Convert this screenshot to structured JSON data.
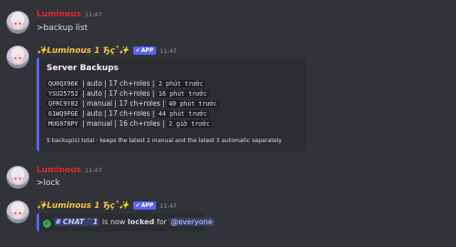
{
  "messages": [
    {
      "username": "Luminous",
      "time": "11:47",
      "text": ">backup list"
    },
    {
      "username": "✨Luminous 1 Ђç˚✨",
      "badge": "APP",
      "time": "11:47",
      "embed": {
        "title": "Server Backups",
        "rows": [
          {
            "id": "QU0QX96K",
            "type": "auto",
            "roles": "17 ch+roles",
            "age": "2 phút trước"
          },
          {
            "id": "YSU25752",
            "type": "auto",
            "roles": "17 ch+roles",
            "age": "16 phút trước"
          },
          {
            "id": "QFRC9Y02",
            "type": "manual",
            "roles": "17 ch+roles",
            "age": "40 phút trước"
          },
          {
            "id": "61WQ9PGE",
            "type": "auto",
            "roles": "17 ch+roles",
            "age": "44 phút trước"
          },
          {
            "id": "MUG978PY",
            "type": "manual",
            "roles": "16 ch+roles",
            "age": "2 giờ trước"
          }
        ],
        "footer": "5 backup(s) total · keeps the latest 2 manual and the latest 3 automatic separately"
      }
    },
    {
      "username": "Luminous",
      "time": "11:47",
      "text": ">lock"
    },
    {
      "username": "✨Luminous 1 Ђç˚✨",
      "badge": "APP",
      "time": "11:47",
      "lock": {
        "channel": "# CHAT ˙ 1",
        "is_now": "is now",
        "locked": "locked",
        "for": "for",
        "mention": "@everyone"
      }
    }
  ],
  "colors": {
    "background": "#313338",
    "embed_bg": "#2b2d31",
    "accent": "#5865f2",
    "user_red": "#e6262f",
    "bot_gold": "#f5c542",
    "success": "#3ba55c"
  }
}
